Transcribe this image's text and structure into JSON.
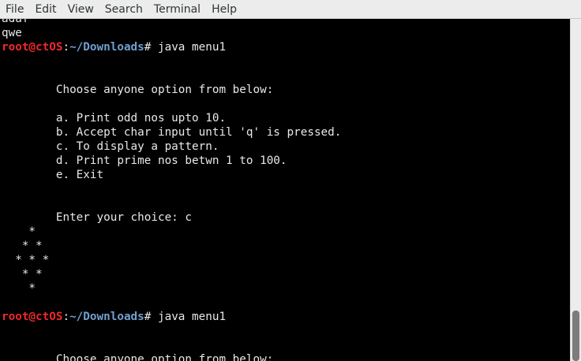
{
  "menubar": {
    "items": [
      "File",
      "Edit",
      "View",
      "Search",
      "Terminal",
      "Help"
    ]
  },
  "terminal": {
    "lines": [
      {
        "type": "text",
        "text": "adaf"
      },
      {
        "type": "text",
        "text": "qwe"
      },
      {
        "type": "prompt",
        "user": "root@ctOS",
        "sep": ":",
        "path": "~/Downloads",
        "tail": "# java menu1"
      },
      {
        "type": "text",
        "text": ""
      },
      {
        "type": "text",
        "text": ""
      },
      {
        "type": "text",
        "text": "        Choose anyone option from below:"
      },
      {
        "type": "text",
        "text": ""
      },
      {
        "type": "text",
        "text": "        a. Print odd nos upto 10."
      },
      {
        "type": "text",
        "text": "        b. Accept char input until 'q' is pressed."
      },
      {
        "type": "text",
        "text": "        c. To display a pattern."
      },
      {
        "type": "text",
        "text": "        d. Print prime nos betwn 1 to 100."
      },
      {
        "type": "text",
        "text": "        e. Exit"
      },
      {
        "type": "text",
        "text": ""
      },
      {
        "type": "text",
        "text": ""
      },
      {
        "type": "text",
        "text": "        Enter your choice: c"
      },
      {
        "type": "text",
        "text": "    *"
      },
      {
        "type": "text",
        "text": "   * *"
      },
      {
        "type": "text",
        "text": "  * * *"
      },
      {
        "type": "text",
        "text": "   * *"
      },
      {
        "type": "text",
        "text": "    *"
      },
      {
        "type": "text",
        "text": ""
      },
      {
        "type": "prompt",
        "user": "root@ctOS",
        "sep": ":",
        "path": "~/Downloads",
        "tail": "# java menu1"
      },
      {
        "type": "text",
        "text": ""
      },
      {
        "type": "text",
        "text": ""
      },
      {
        "type": "text",
        "text": "        Choose anyone option from below:"
      }
    ]
  },
  "colors": {
    "background": "#000000",
    "text": "#e8e8e8",
    "prompt_user": "#ef2929",
    "prompt_path": "#729fcf",
    "menubar": "#ececec"
  }
}
